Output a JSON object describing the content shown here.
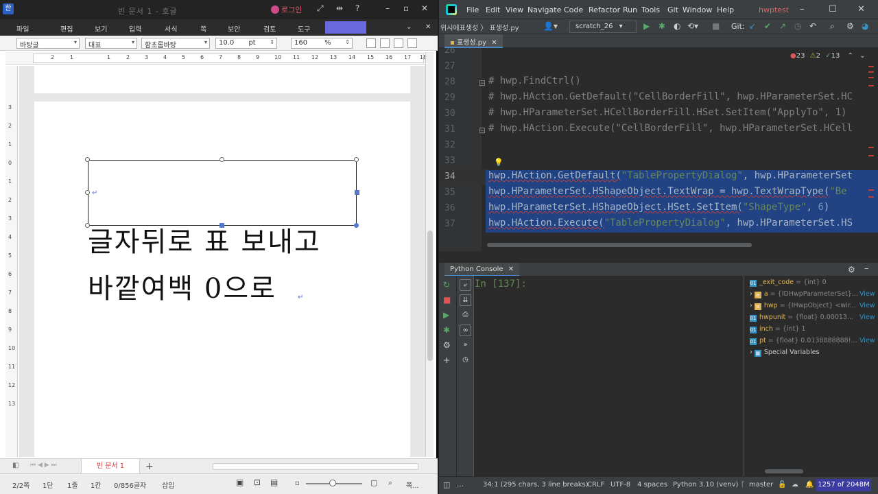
{
  "hwp": {
    "logo": "한",
    "doc_title": "빈 문서 1 - 호글",
    "login": "로그인",
    "menu": [
      "파일",
      "편집",
      "보기",
      "입력",
      "서식",
      "쪽",
      "보안",
      "검토",
      "도구"
    ],
    "format": {
      "style": "바탕글",
      "lang": "대표",
      "font": "함초롬바탕",
      "size": "10.0",
      "unit": "pt",
      "zoom": "160",
      "zoom_unit": "%"
    },
    "ruler_numbers": [
      "2",
      "1",
      "1",
      "2",
      "3",
      "4",
      "5",
      "6",
      "7",
      "8",
      "9",
      "10",
      "11",
      "12",
      "13",
      "14",
      "15",
      "16",
      "17",
      "18"
    ],
    "ruler_v_numbers": [
      "3",
      "2",
      "1",
      "0",
      "1",
      "2",
      "3",
      "4",
      "5",
      "6",
      "7",
      "8",
      "9",
      "10",
      "11",
      "12",
      "13"
    ],
    "text_line1": "글자뒤로 표 보내고",
    "text_line2": "바깥여백 0으로",
    "doc_tab": "빈 문서 1",
    "status": {
      "page": "2/2쪽",
      "section": "1단",
      "line": "1줄",
      "col": "1칸",
      "chars": "0/856글자",
      "mode": "삽입",
      "zoom_label": "쪽..."
    }
  },
  "ide": {
    "menu": [
      "File",
      "Edit",
      "View",
      "Navigate",
      "Code",
      "Refactor",
      "Run",
      "Tools",
      "Git",
      "Window",
      "Help"
    ],
    "project": "hwptest",
    "breadcrumb": "위시에표생성 〉 표생성.py",
    "run_config": "scratch_26",
    "git_label": "Git:",
    "file_tab": "표생성.py",
    "inspections": {
      "errors": "23",
      "warnings": "2",
      "ok": "13"
    },
    "line_numbers": [
      "26",
      "27",
      "28",
      "29",
      "30",
      "31",
      "32",
      "33",
      "34",
      "35",
      "36",
      "37"
    ],
    "code": {
      "l28": "# hwp.FindCtrl()",
      "l29": "# hwp.HAction.GetDefault(\"CellBorderFill\", hwp.HParameterSet.HC",
      "l30": "# hwp.HParameterSet.HCellBorderFill.HSet.SetItem(\"ApplyTo\", 1)",
      "l31": "# hwp.HAction.Execute(\"CellBorderFill\", hwp.HParameterSet.HCell",
      "l34a": "hwp.HAction.GetDefault(",
      "l34b": "\"TablePropertyDialog\"",
      "l34c": ", hwp.HParameterSet",
      "l35a": "hwp.HParameterSet.HShapeObject.TextWrap = hwp.TextWrapType(",
      "l35b": "\"Be",
      "l36a": "hwp.HParameterSet.HShapeObject.HSet.SetItem(",
      "l36b": "\"ShapeType\"",
      "l36c": ", ",
      "l36d": "6",
      "l36e": ")",
      "l37a": "hwp.HAction.Execute(",
      "l37b": "\"TablePropertyDialog\"",
      "l37c": ", hwp.HParameterSet.HS"
    },
    "console_tab": "Python Console",
    "prompt": "In [137]:",
    "vars": [
      {
        "name": "_exit_code",
        "desc": " = {int} 0",
        "view": ""
      },
      {
        "name": "a",
        "desc": " = {IDHwpParameterSet}...",
        "view": "View"
      },
      {
        "name": "hwp",
        "desc": " = {IHwpObject} <wir...",
        "view": "View"
      },
      {
        "name": "hwpunit",
        "desc": " = {float} 0.00013...",
        "view": "View"
      },
      {
        "name": "inch",
        "desc": " = {int} 1",
        "view": ""
      },
      {
        "name": "pt",
        "desc": " = {float} 0.0138888888!...",
        "view": "View"
      },
      {
        "name": "Special Variables",
        "desc": "",
        "view": ""
      }
    ],
    "status": {
      "position": "34:1 (295 chars, 3 line breaks)",
      "eol": "CRLF",
      "encoding": "UTF-8",
      "indent": "4 spaces",
      "interpreter": "Python 3.10 (venv)",
      "branch": "master",
      "memory": "1257 of 2048M"
    }
  }
}
